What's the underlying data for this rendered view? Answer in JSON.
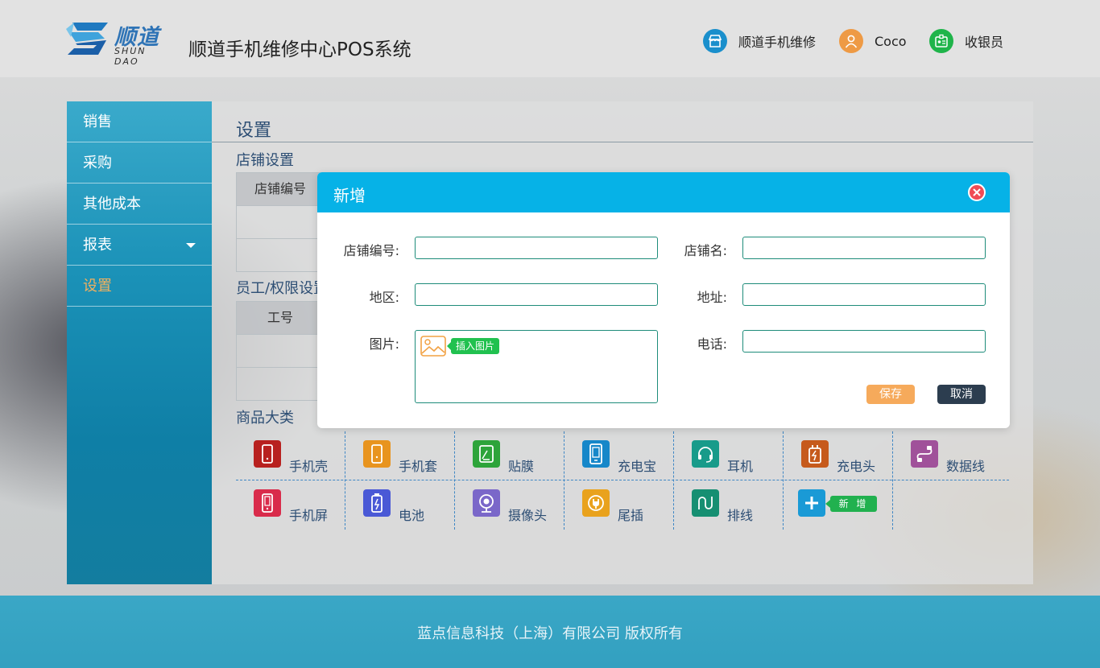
{
  "header": {
    "logo_cn": "顺道",
    "logo_en": "SHUN DAO",
    "app_title": "顺道手机维修中心POS系统",
    "store_label": "顺道手机维修",
    "user_name": "Coco",
    "role": "收银员"
  },
  "sidebar": {
    "items": [
      {
        "label": "销售"
      },
      {
        "label": "采购"
      },
      {
        "label": "其他成本"
      },
      {
        "label": "报表"
      },
      {
        "label": "设置"
      }
    ]
  },
  "main": {
    "page_title": "设置",
    "store_section": "店铺设置",
    "store_table_header": "店铺编号",
    "staff_section": "员工/权限设置",
    "staff_table_header": "工号",
    "category_section": "商品大类",
    "categories": [
      {
        "label": "手机壳",
        "color": "#b8211f",
        "icon": "phone-case-icon"
      },
      {
        "label": "手机套",
        "color": "#e8941f",
        "icon": "phone-cover-icon"
      },
      {
        "label": "贴膜",
        "color": "#2da43a",
        "icon": "screen-film-icon"
      },
      {
        "label": "充电宝",
        "color": "#1687c9",
        "icon": "power-bank-icon"
      },
      {
        "label": "耳机",
        "color": "#189b8a",
        "icon": "headphone-icon"
      },
      {
        "label": "充电头",
        "color": "#c65a1c",
        "icon": "charger-icon"
      },
      {
        "label": "数据线",
        "color": "#a0519a",
        "icon": "cable-icon"
      },
      {
        "label": "手机屏",
        "color": "#d92b4b",
        "icon": "phone-screen-icon"
      },
      {
        "label": "电池",
        "color": "#4a59d6",
        "icon": "battery-icon"
      },
      {
        "label": "摄像头",
        "color": "#7a67c9",
        "icon": "camera-icon"
      },
      {
        "label": "尾插",
        "color": "#e9a21d",
        "icon": "plug-icon"
      },
      {
        "label": "排线",
        "color": "#168f72",
        "icon": "flex-cable-icon"
      }
    ],
    "add_label": "新 增",
    "add_color": "#1a9ad6"
  },
  "modal": {
    "title": "新增",
    "fields": {
      "store_no_label": "店铺编号:",
      "store_name_label": "店铺名:",
      "region_label": "地区:",
      "address_label": "地址:",
      "image_label": "图片:",
      "phone_label": "电话:",
      "store_no_value": "",
      "store_name_value": "",
      "region_value": "",
      "address_value": "",
      "phone_value": ""
    },
    "insert_image_label": "插入图片",
    "save_label": "保存",
    "cancel_label": "取消"
  },
  "footer": {
    "copyright": "蓝点信息科技（上海）有限公司  版权所有"
  },
  "colors": {
    "accent": "#06b2e7",
    "sidebar": "#1b92b8",
    "active_nav": "#f2b05e",
    "save": "#f6aa5b",
    "cancel": "#2c3d4f",
    "close": "#ef4b55"
  }
}
